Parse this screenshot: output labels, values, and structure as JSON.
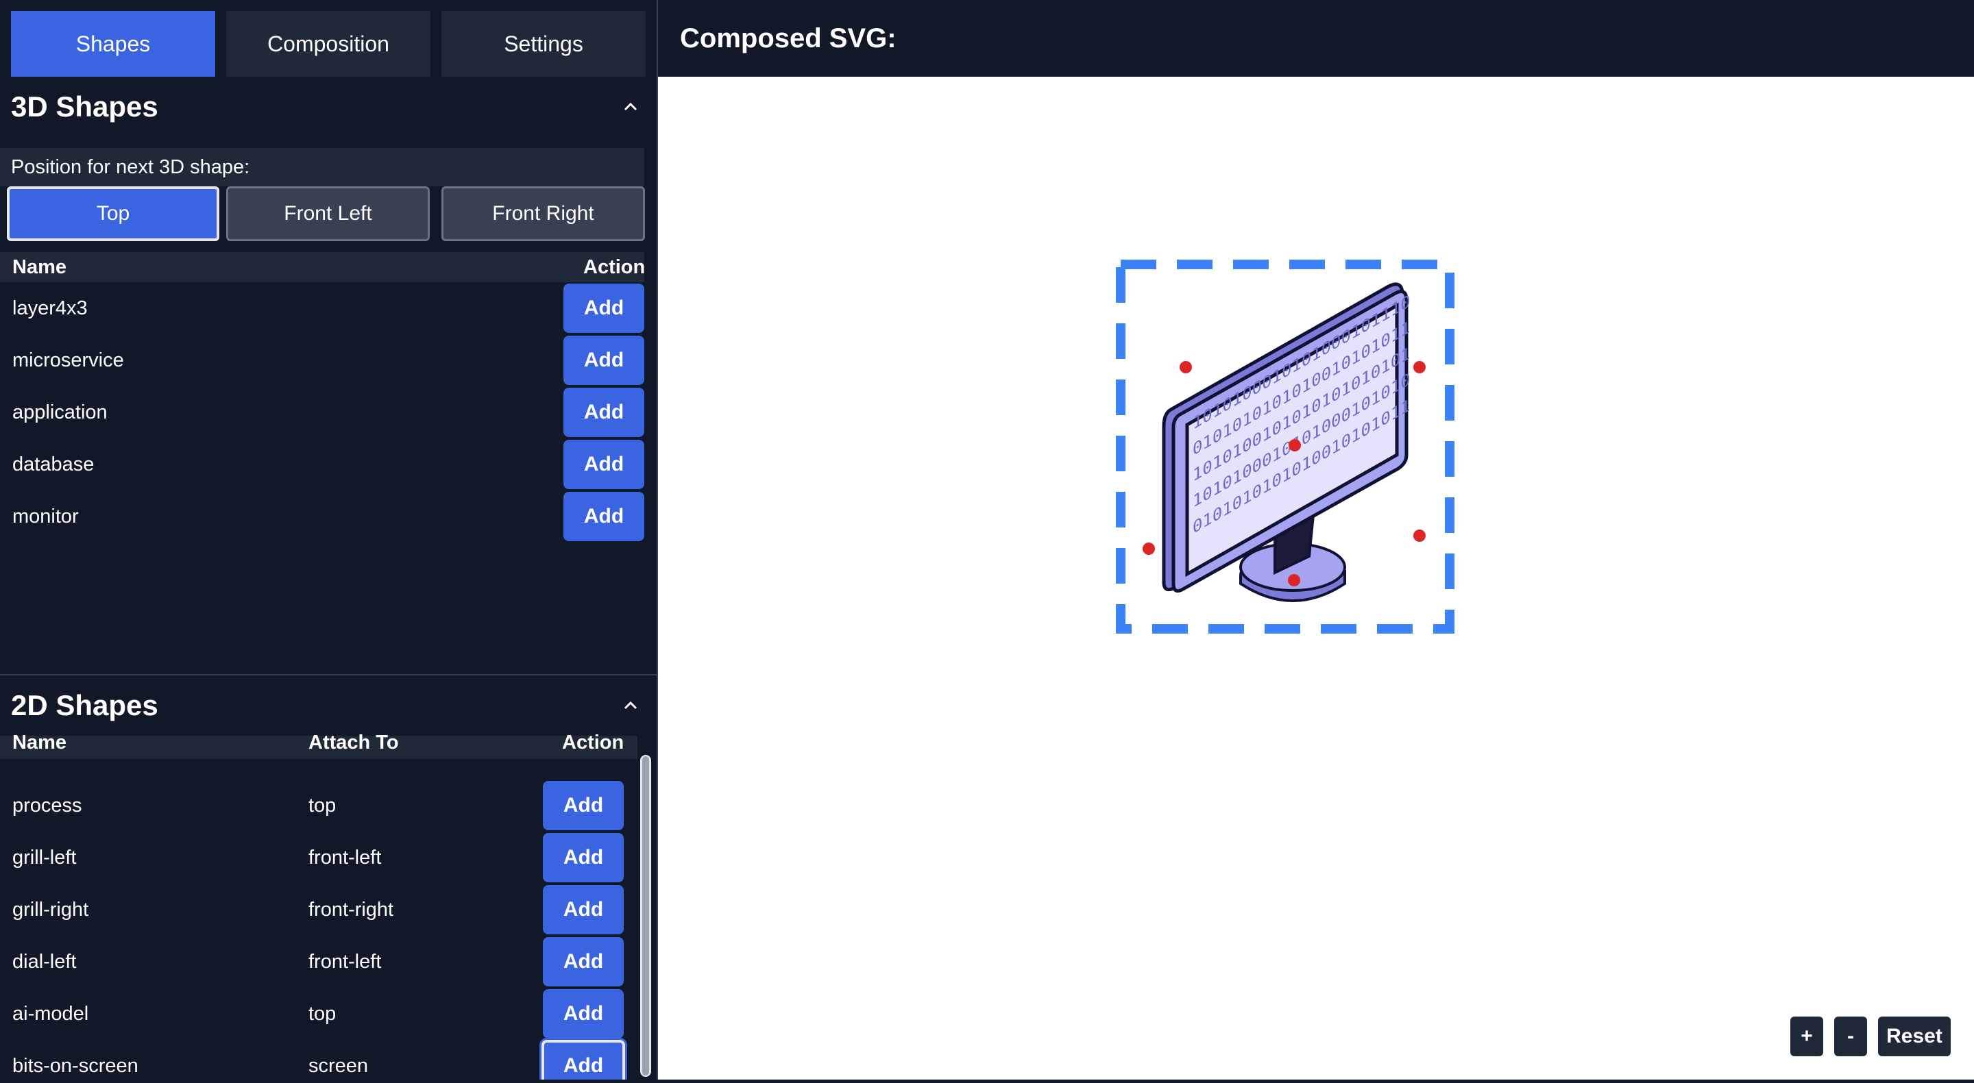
{
  "tabs": [
    {
      "label": "Shapes",
      "active": true
    },
    {
      "label": "Composition",
      "active": false
    },
    {
      "label": "Settings",
      "active": false
    }
  ],
  "shapes3d": {
    "title": "3D Shapes",
    "position_label": "Position for next 3D shape:",
    "positions": [
      {
        "label": "Top",
        "active": true
      },
      {
        "label": "Front Left",
        "active": false
      },
      {
        "label": "Front Right",
        "active": false
      }
    ],
    "columns": {
      "name": "Name",
      "action": "Action"
    },
    "rows": [
      {
        "name": "layer4x3",
        "action": "Add"
      },
      {
        "name": "microservice",
        "action": "Add"
      },
      {
        "name": "application",
        "action": "Add"
      },
      {
        "name": "database",
        "action": "Add"
      },
      {
        "name": "monitor",
        "action": "Add"
      }
    ]
  },
  "shapes2d": {
    "title": "2D Shapes",
    "columns": {
      "name": "Name",
      "attach": "Attach To",
      "action": "Action"
    },
    "rows": [
      {
        "name": "process",
        "attach": "top",
        "action": "Add"
      },
      {
        "name": "grill-left",
        "attach": "front-left",
        "action": "Add"
      },
      {
        "name": "grill-right",
        "attach": "front-right",
        "action": "Add"
      },
      {
        "name": "dial-left",
        "attach": "front-left",
        "action": "Add"
      },
      {
        "name": "ai-model",
        "attach": "top",
        "action": "Add"
      },
      {
        "name": "bits-on-screen",
        "attach": "screen",
        "action": "Add"
      }
    ]
  },
  "preview": {
    "title": "Composed SVG:",
    "screen_bits": [
      "1010100010101000101110",
      "0101010101010010101011",
      "1010100101010101010101",
      "1010100010101000101010",
      "0101010101010010101011"
    ],
    "zoom_in": "+",
    "zoom_out": "-",
    "reset": "Reset"
  },
  "colors": {
    "accent": "#3b65e0",
    "panel": "#111827",
    "surface": "#1f2937",
    "selection": "#3b82f6",
    "handle": "#dc2626",
    "monitor": "#a5a4f0"
  }
}
